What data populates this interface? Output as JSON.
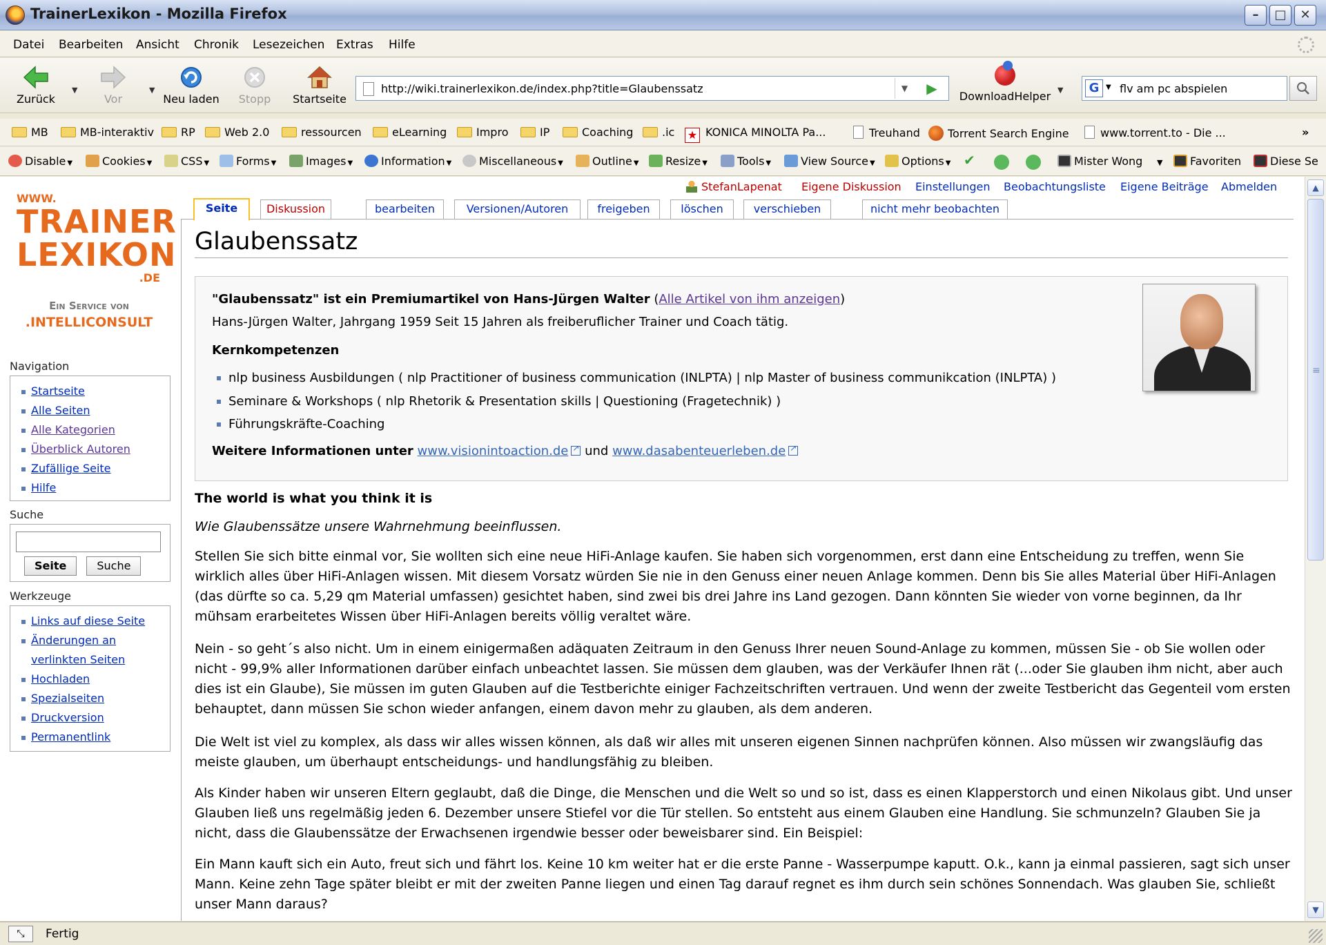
{
  "window": {
    "title": "TrainerLexikon - Mozilla Firefox"
  },
  "menu": [
    "Datei",
    "Bearbeiten",
    "Ansicht",
    "Chronik",
    "Lesezeichen",
    "Extras",
    "Hilfe"
  ],
  "nav": {
    "back": "Zurück",
    "forward": "Vor",
    "reload": "Neu laden",
    "stop": "Stopp",
    "home": "Startseite",
    "url": "http://wiki.trainerlexikon.de/index.php?title=Glaubenssatz",
    "downloadhelper": "DownloadHelper",
    "search_value": "flv am pc abspielen"
  },
  "bookmarks": [
    "MB",
    "MB-interaktiv",
    "RP",
    "Web 2.0",
    "ressourcen",
    "eLearning",
    "Impro",
    "IP",
    "Coaching",
    ".ic",
    "KONICA MINOLTA Pa...",
    "Treuhand",
    "Torrent Search Engine",
    "www.torrent.to - Die ...",
    "»"
  ],
  "devbar": [
    "Disable",
    "Cookies",
    "CSS",
    "Forms",
    "Images",
    "Information",
    "Miscellaneous",
    "Outline",
    "Resize",
    "Tools",
    "View Source",
    "Options",
    "Mister Wong",
    "Favoriten",
    "Diese Se"
  ],
  "logo": {
    "www": "WWW.",
    "line1": "TRAINER",
    "line2": "LEXIKON",
    "de": ".DE",
    "service": "Ein Service von",
    "company": ".INTELLICONSULT"
  },
  "sidebar": {
    "nav_title": "Navigation",
    "nav_items": [
      "Startseite",
      "Alle Seiten",
      "Alle Kategorien",
      "Überblick Autoren",
      "Zufällige Seite",
      "Hilfe"
    ],
    "search_title": "Suche",
    "search_go": "Seite",
    "search_btn": "Suche",
    "tools_title": "Werkzeuge",
    "tools_items": [
      "Links auf diese Seite",
      "Änderungen an",
      "verlinkten Seiten",
      "Hochladen",
      "Spezialseiten",
      "Druckversion",
      "Permanentlink"
    ]
  },
  "personal": [
    "StefanLapenat",
    "Eigene Diskussion",
    "Einstellungen",
    "Beobachtungsliste",
    "Eigene Beiträge",
    "Abmelden"
  ],
  "tabs": [
    "Seite",
    "Diskussion",
    "bearbeiten",
    "Versionen/Autoren",
    "freigeben",
    "löschen",
    "verschieben",
    "nicht mehr beobachten"
  ],
  "article": {
    "title": "Glaubenssatz",
    "info_head": "\"Glaubenssatz\" ist ein Premiumartikel von Hans-Jürgen Walter",
    "info_link": "Alle Artikel von ihm anzeigen",
    "paren_open": " (",
    "paren_close": ")",
    "info_bio": "Hans-Jürgen Walter, Jahrgang 1959 Seit 15 Jahren als freiberuflicher Trainer und Coach tätig.",
    "kern": "Kernkompetenzen",
    "kern_items": [
      "nlp business Ausbildungen ( nlp Practitioner of business communication (INLPTA) | nlp Master of business communikcation (INLPTA) )",
      "Seminare & Workshops ( nlp Rhetorik & Presentation skills | Questioning (Fragetechnik) )",
      "Führungskräfte-Coaching"
    ],
    "more_label": "Weitere Informationen unter",
    "link1": "www.visionintoaction.de",
    "und": "und",
    "link2": "www.dasabenteuerleben.de",
    "heading": "The world is what you think it is",
    "subtitle": "Wie Glaubenssätze unsere Wahrnehmung beeinflussen.",
    "p1": "Stellen Sie sich bitte einmal vor, Sie wollten sich eine neue HiFi-Anlage kaufen. Sie haben sich vorgenommen, erst dann eine Entscheidung zu treffen, wenn Sie wirklich alles über HiFi-Anlagen wissen. Mit diesem Vorsatz würden Sie nie in den Genuss einer neuen Anlage kommen. Denn bis Sie alles Material über HiFi-Anlagen (das dürfte so ca. 5,29 qm Material umfassen) gesichtet haben, sind zwei bis drei Jahre ins Land gezogen. Dann könnten Sie wieder von vorne beginnen, da Ihr mühsam erarbeitetes Wissen über HiFi-Anlagen bereits völlig veraltet wäre.",
    "p2": "Nein - so geht´s also nicht. Um in einem einigermaßen adäquaten Zeitraum in den Genuss Ihrer neuen Sound-Anlage zu kommen, müssen Sie - ob Sie wollen oder nicht - 99,9% aller Informationen darüber einfach unbeachtet lassen. Sie müssen dem glauben, was der Verkäufer Ihnen rät (...oder Sie glauben ihm nicht, aber auch dies ist ein Glaube), Sie müssen im guten Glauben auf die Testberichte einiger Fachzeitschriften vertrauen. Und wenn der zweite Testbericht das Gegenteil vom ersten behauptet, dann müssen Sie schon wieder anfangen, einem davon mehr zu glauben, als dem anderen.",
    "p3": "Die Welt ist viel zu komplex, als dass wir alles wissen können, als daß wir alles mit unseren eigenen Sinnen nachprüfen können. Also müssen wir zwangsläufig das meiste glauben, um überhaupt entscheidungs- und handlungsfähig zu bleiben.",
    "p4": "Als Kinder haben wir unseren Eltern geglaubt, daß die Dinge, die Menschen und die Welt so und so ist, dass es einen Klapperstorch und einen Nikolaus gibt. Und unser Glauben ließ uns regelmäßig jeden 6. Dezember unsere Stiefel vor die Tür stellen. So entsteht aus einem Glauben eine Handlung. Sie schmunzeln? Glauben Sie ja nicht, dass die Glaubenssätze der Erwachsenen irgendwie besser oder beweisbarer sind. Ein Beispiel:",
    "p5": "Ein Mann kauft sich ein Auto, freut sich und fährt los. Keine 10 km weiter hat er die erste Panne - Wasserpumpe kaputt. O.k., kann ja einmal passieren, sagt sich unser Mann. Keine zehn Tage später bleibt er mit der zweiten Panne liegen und einen Tag darauf regnet es ihm durch sein schönes Sonnendach. Was glauben Sie, schließt unser Mann daraus?"
  },
  "status": {
    "text": "Fertig"
  }
}
